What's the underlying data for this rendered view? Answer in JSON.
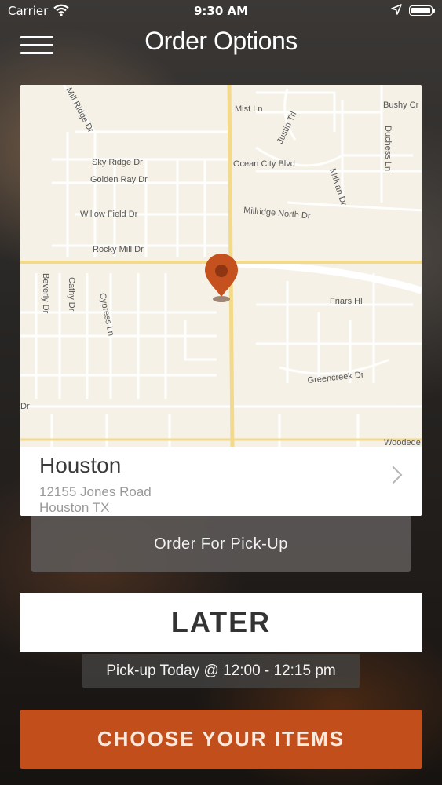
{
  "status_bar": {
    "carrier": "Carrier",
    "time": "9:30 AM",
    "wifi_icon": "wifi-icon",
    "location_icon": "location-arrow-icon",
    "battery_icon": "battery-icon"
  },
  "nav": {
    "title": "Order Options",
    "menu_icon": "hamburger-menu-icon"
  },
  "map": {
    "street_labels": [
      "Mill Ridge Dr",
      "Mist Ln",
      "Bushy Cr",
      "Justin Trl",
      "Duchess Ln",
      "Sky Ridge Dr",
      "Ocean City Blvd",
      "Golden Ray Dr",
      "Millvan Dr",
      "Willow Field Dr",
      "Millridge North Dr",
      "Rocky Mill Dr",
      "Beverly Dr",
      "Cathy Dr",
      "Cypress Ln",
      "Friars Hl",
      "Greencreek Dr",
      "Woodede",
      "Dr"
    ],
    "pin_icon": "map-pin-icon",
    "road_color": "#f3d98a",
    "pin_color": "#c5511f"
  },
  "store": {
    "name": "Houston",
    "address_line1": "12155 Jones Road",
    "address_line2": "Houston TX"
  },
  "order_type": {
    "label": "Order For Pick-Up"
  },
  "later_button": {
    "label": "LATER"
  },
  "pickup_time": {
    "label": "Pick-up Today @ 12:00 - 12:15 pm"
  },
  "choose_button": {
    "label": "CHOOSE YOUR ITEMS",
    "color": "#c14e1b"
  }
}
